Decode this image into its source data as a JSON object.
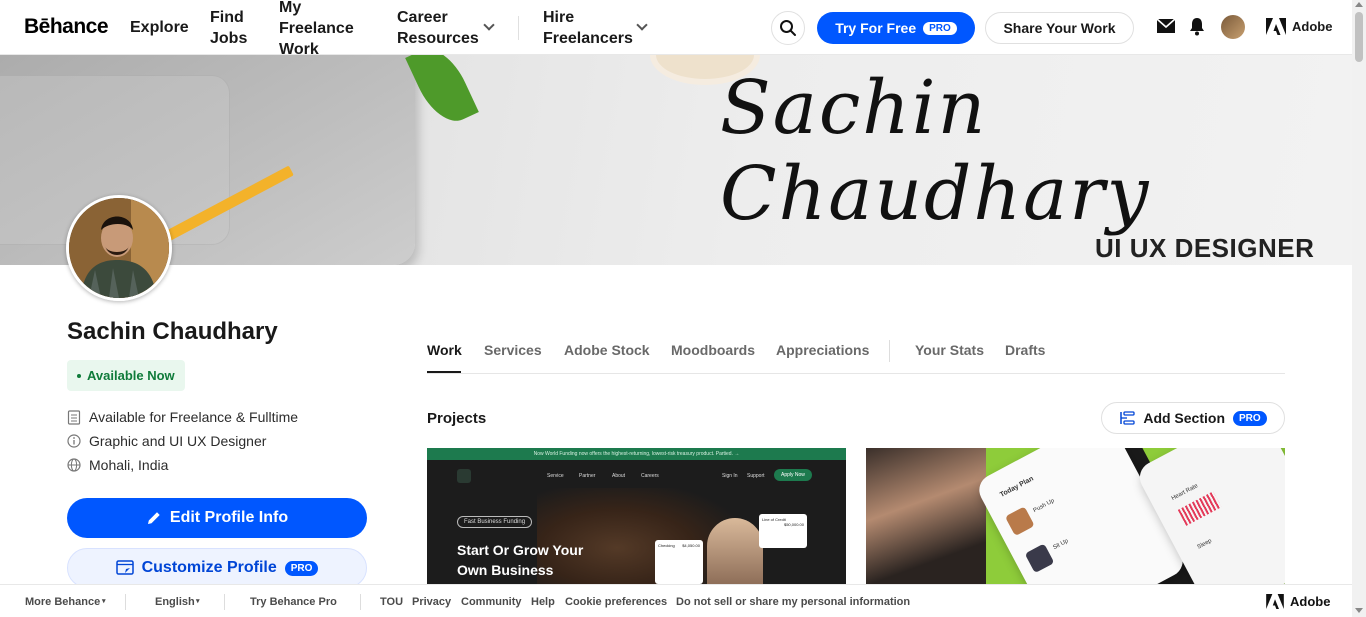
{
  "header": {
    "logo": "Bēhance",
    "nav": {
      "explore": "Explore",
      "find_jobs_1": "Find",
      "find_jobs_2": "Jobs",
      "freelance_1": "My",
      "freelance_2": "Freelance",
      "freelance_3": "Work",
      "career_1": "Career",
      "career_2": "Resources",
      "hire_1": "Hire",
      "hire_2": "Freelancers"
    },
    "try_label": "Try For Free",
    "pro_badge": "PRO",
    "share_label": "Share Your Work",
    "adobe_label": "Adobe"
  },
  "banner": {
    "signature": "Sachin Chaudhary",
    "role": "UI UX DESIGNER"
  },
  "profile": {
    "name": "Sachin Chaudhary",
    "availability": "Available Now",
    "details": [
      "Available for Freelance & Fulltime",
      "Graphic and UI UX Designer",
      "Mohali, India"
    ],
    "edit_label": "Edit Profile Info",
    "customize_label": "Customize Profile",
    "pro_badge": "PRO"
  },
  "tabs": [
    "Work",
    "Services",
    "Adobe Stock",
    "Moodboards",
    "Appreciations",
    "Your Stats",
    "Drafts"
  ],
  "projects": {
    "title": "Projects",
    "add_section_label": "Add Section",
    "pro_badge": "PRO",
    "card1": {
      "banner_text": "Now World Funding now offers the highest-returning, lowest-risk treasury product. Partied. →",
      "nav": [
        "Service",
        "Partner",
        "About",
        "Careers"
      ],
      "sign_in": "Sign In",
      "support": "Support",
      "apply": "Apply Now",
      "pill": "Fast Business Funding",
      "headline_1": "Start  Or Grow Your",
      "headline_2": "Own Business",
      "widget_value": "$4,050.00",
      "widget_label": "Checking",
      "widget2_label": "Line of Credit",
      "widget2_value": "$50,000.00"
    },
    "card2": {
      "labels": [
        "Today Plan",
        "Push Up",
        "Sit Up",
        "Heart Rate",
        "Sleep"
      ]
    }
  },
  "footer": {
    "items": [
      "More Behance",
      "English",
      "Try Behance Pro",
      "TOU",
      "Privacy",
      "Community",
      "Help",
      "Cookie preferences",
      "Do not sell or share my personal information"
    ],
    "adobe_label": "Adobe"
  },
  "colors": {
    "primary": "#0057ff",
    "available_bg": "#e9f7ee",
    "available_text": "#0f7b3a"
  }
}
